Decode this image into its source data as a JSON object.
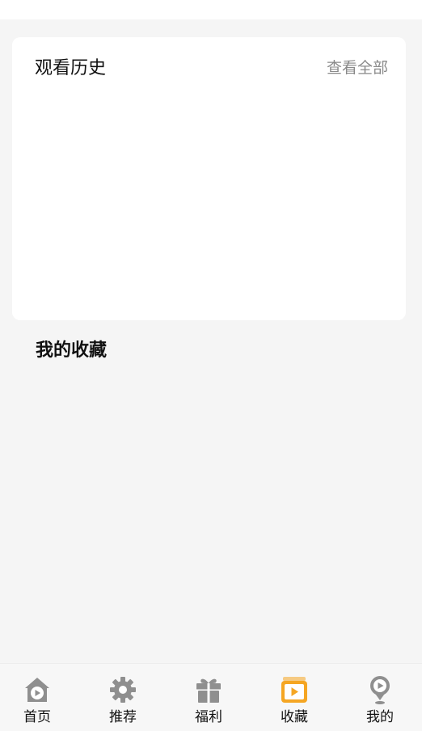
{
  "history": {
    "title": "观看历史",
    "view_all": "查看全部"
  },
  "favorites": {
    "title": "我的收藏"
  },
  "tabbar": {
    "active_color": "#f5a623",
    "inactive_color": "#8f8f8f",
    "items": [
      {
        "label": "首页",
        "icon": "home-play-icon"
      },
      {
        "label": "推荐",
        "icon": "gear-icon"
      },
      {
        "label": "福利",
        "icon": "gift-icon"
      },
      {
        "label": "收藏",
        "icon": "tv-play-icon",
        "active": true
      },
      {
        "label": "我的",
        "icon": "profile-pin-icon"
      }
    ]
  }
}
